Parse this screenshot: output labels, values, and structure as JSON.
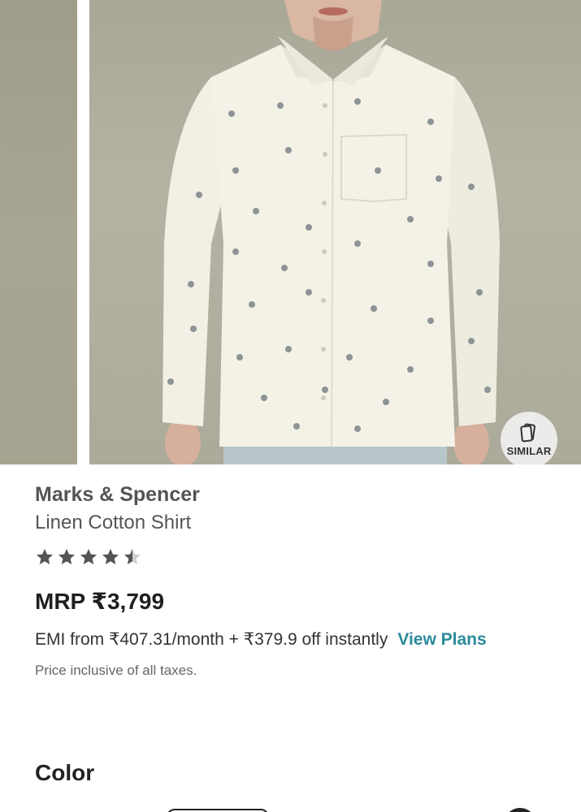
{
  "gallery": {
    "similar_label": "SIMILAR"
  },
  "product": {
    "brand": "Marks & Spencer",
    "name": "Linen Cotton Shirt",
    "rating": 4.5,
    "rating_max": 5,
    "price": "MRP ₹3,799",
    "emi_text": "EMI from ₹407.31/month + ₹379.9 off instantly",
    "emi_link": "View Plans",
    "tax_note": "Price inclusive of all taxes."
  },
  "sections": {
    "color_heading": "Color"
  },
  "colors": {
    "star": "#555555",
    "link": "#2b8a9b",
    "text": "#222222"
  },
  "icons": {
    "similar": "cards-icon",
    "rating": "star-icon"
  }
}
